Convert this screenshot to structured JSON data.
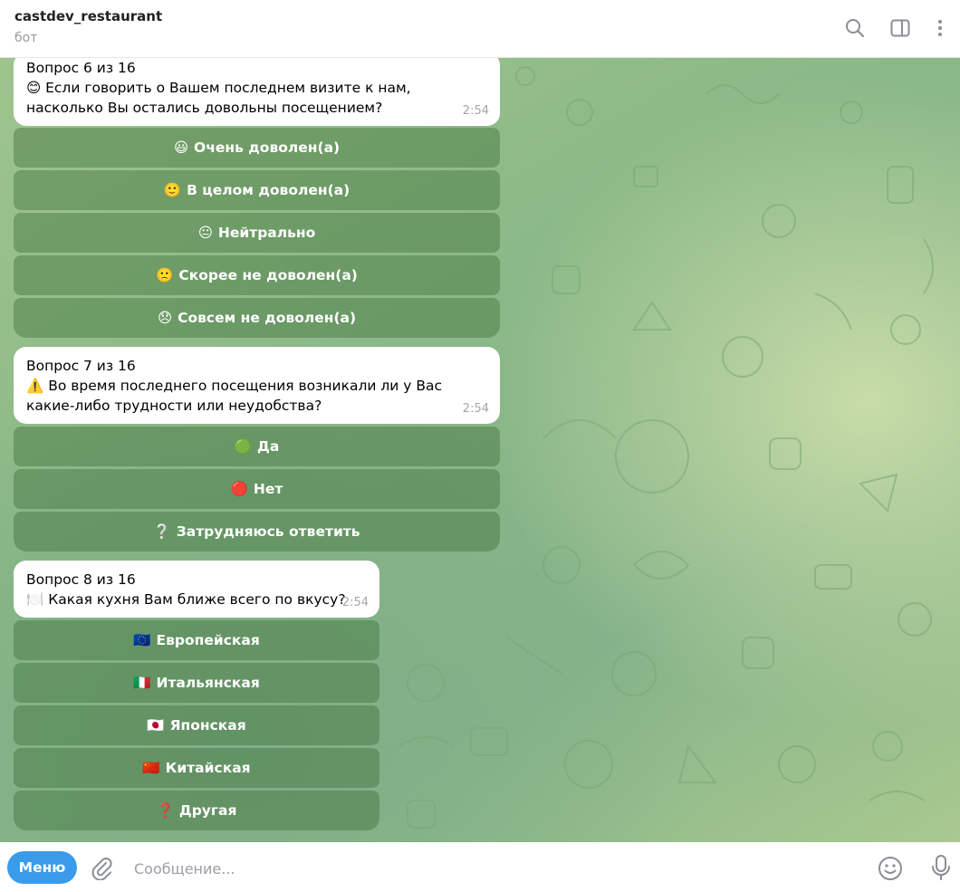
{
  "header": {
    "title": "castdev_restaurant",
    "subtitle": "бот",
    "icons": [
      "search-icon",
      "sidebar-toggle-icon",
      "more-vertical-icon"
    ]
  },
  "messages": [
    {
      "question": "Вопрос 6 из 16",
      "emoji": "😊",
      "text": "Если говорить о Вашем последнем визите к нам, насколько Вы остались довольны посещением?",
      "time": "2:54",
      "buttons": [
        {
          "emoji": "😃",
          "label": "Очень доволен(а)"
        },
        {
          "emoji": "🙂",
          "label": "В целом доволен(а)"
        },
        {
          "emoji": "😐",
          "label": "Нейтрально"
        },
        {
          "emoji": "🙁",
          "label": "Скорее не доволен(а)"
        },
        {
          "emoji": "😞",
          "label": "Совсем не доволен(а)"
        }
      ]
    },
    {
      "question": "Вопрос 7 из 16",
      "emoji": "⚠️",
      "text": "Во время последнего посещения возникали ли у Вас какие-либо трудности или неудобства?",
      "time": "2:54",
      "buttons": [
        {
          "emoji": "🟢",
          "label": "Да"
        },
        {
          "emoji": "🔴",
          "label": "Нет"
        },
        {
          "emoji": "❔",
          "label": "Затрудняюсь ответить"
        }
      ]
    },
    {
      "question": "Вопрос 8 из 16",
      "emoji": "🍽️",
      "text": "Какая кухня Вам ближе всего по вкусу?",
      "time": "2:54",
      "buttons": [
        {
          "emoji": "🇪🇺",
          "label": "Европейская"
        },
        {
          "emoji": "🇮🇹",
          "label": "Итальянская"
        },
        {
          "emoji": "🇯🇵",
          "label": "Японская"
        },
        {
          "emoji": "🇨🇳",
          "label": "Китайская"
        },
        {
          "emoji": "❓",
          "label": "Другая"
        }
      ]
    }
  ],
  "footer": {
    "menu_label": "Меню",
    "input_placeholder": "Сообщение...",
    "input_value": ""
  },
  "colors": {
    "accent": "#3a9bea",
    "keyboard_button": "#5c8a55"
  }
}
